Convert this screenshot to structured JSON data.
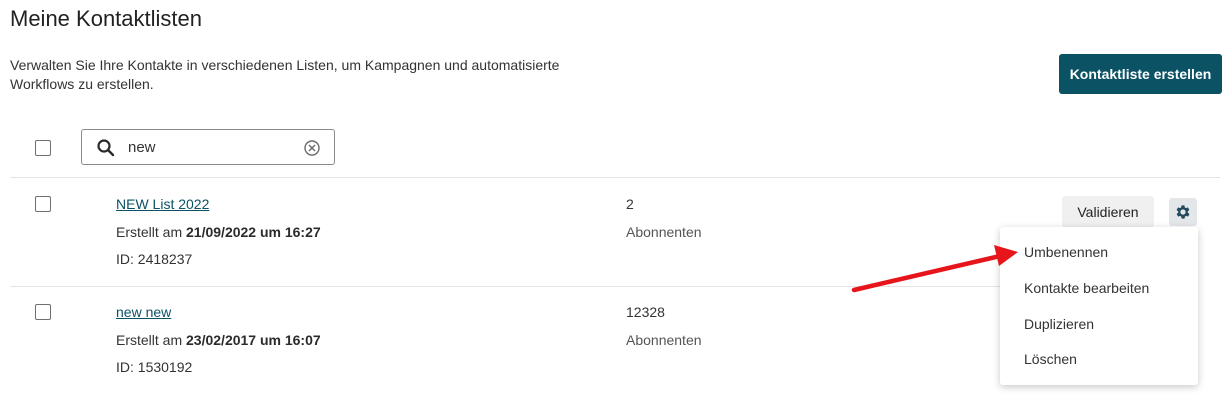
{
  "page": {
    "title": "Meine Kontaktlisten",
    "description": "Verwalten Sie Ihre Kontakte in verschiedenen Listen, um Kampagnen und automatisierte Workflows zu erstellen.",
    "create_button": "Kontaktliste erstellen"
  },
  "search": {
    "value": "new",
    "icon": "search-icon",
    "clear_icon": "clear-circle-icon"
  },
  "lists": [
    {
      "name": "NEW List 2022",
      "created_prefix": "Erstellt am ",
      "created_date": "21/09/2022 um 16:27",
      "id_text": "ID: 2418237",
      "subscriber_count": "2",
      "subscriber_label": "Abonnenten",
      "validate_label": "Validieren"
    },
    {
      "name": "new new",
      "created_prefix": "Erstellt am ",
      "created_date": "23/02/2017 um 16:07",
      "id_text": "ID: 1530192",
      "subscriber_count": "12328",
      "subscriber_label": "Abonnenten"
    }
  ],
  "menu": {
    "items": [
      "Umbenennen",
      "Kontakte bearbeiten",
      "Duplizieren",
      "Löschen"
    ]
  },
  "colors": {
    "primary": "#0b5265",
    "annotation_arrow": "#e8141b"
  }
}
